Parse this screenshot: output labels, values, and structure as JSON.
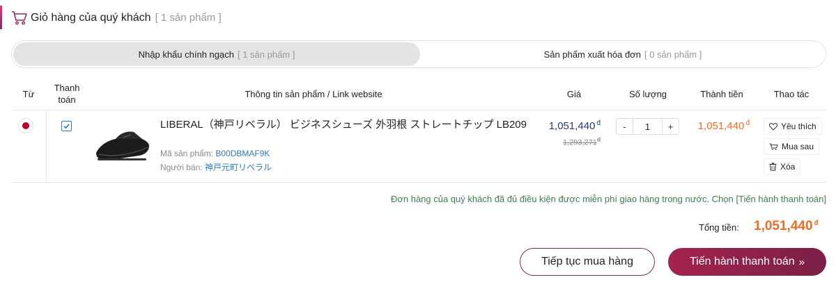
{
  "header": {
    "title": "Giỏ hàng của quý khách",
    "count": "[ 1 sản phẩm ]"
  },
  "tabs": [
    {
      "label": "Nhập khẩu chính ngạch",
      "count": "[ 1 sản phẩm ]",
      "active": true
    },
    {
      "label": "Sản phẩm xuất hóa đơn",
      "count": "[ 0 sản phẩm ]",
      "active": false
    }
  ],
  "table": {
    "headers": {
      "from": "Từ",
      "pay_line1": "Thanh",
      "pay_line2": "toán",
      "info": "Thông tin sản phẩm / Link website",
      "price": "Giá",
      "qty": "Số lượng",
      "subtotal": "Thành tiền",
      "actions": "Thao tác"
    },
    "rows": [
      {
        "name": "LIBERAL（神戸リベラル） ビジネスシューズ 外羽根 ストレートチップ LB209",
        "sku_label": "Mã sản phẩm:",
        "sku": "B00DBMAF9K",
        "seller_label": "Người bán:",
        "seller": "神戸元町リベラル",
        "price": "1,051,440",
        "old_price": "1,293,271",
        "quantity": "1",
        "subtotal": "1,051,440",
        "currency": "đ"
      }
    ]
  },
  "actions": {
    "wishlist": "Yêu thích",
    "buy_later": "Mua sau",
    "delete": "Xóa"
  },
  "qty_controls": {
    "minus": "-",
    "plus": "+"
  },
  "notice": "Đơn hàng của quý khách đã đủ điều kiện được miễn phí giao hàng trong nước. Chọn [Tiến hành thanh toán]",
  "total": {
    "label": "Tổng tiền:",
    "value": "1,051,440",
    "currency": "đ"
  },
  "buttons": {
    "continue": "Tiếp tục mua hàng",
    "checkout": "Tiến hành thanh toán",
    "checkout_arrow": "»"
  },
  "colors": {
    "accent": "#a4224e",
    "price": "#2a3b6e",
    "orange": "#f26a21",
    "link": "#2a7ab8",
    "notice": "#3e7d4f"
  }
}
